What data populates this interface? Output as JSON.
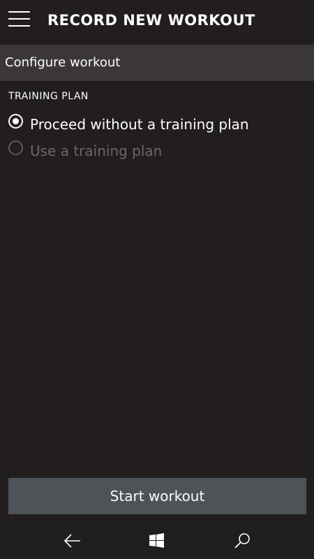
{
  "header": {
    "title": "RECORD NEW WORKOUT",
    "menu_icon": "hamburger-menu-icon"
  },
  "section": {
    "title": "Configure workout"
  },
  "training_plan": {
    "label": "TRAINING PLAN",
    "options": [
      {
        "label": "Proceed without a training plan",
        "selected": true,
        "enabled": true
      },
      {
        "label": "Use a training plan",
        "selected": false,
        "enabled": false
      }
    ]
  },
  "actions": {
    "start_label": "Start workout"
  },
  "navbar": {
    "icons": [
      "back-arrow-icon",
      "windows-logo-icon",
      "search-icon"
    ]
  },
  "colors": {
    "background": "#221e1f",
    "section_bar": "#3b3738",
    "button": "#4d5357",
    "navbar": "#1f1f1f",
    "text": "#ffffff",
    "disabled_text": "#6b6768"
  }
}
